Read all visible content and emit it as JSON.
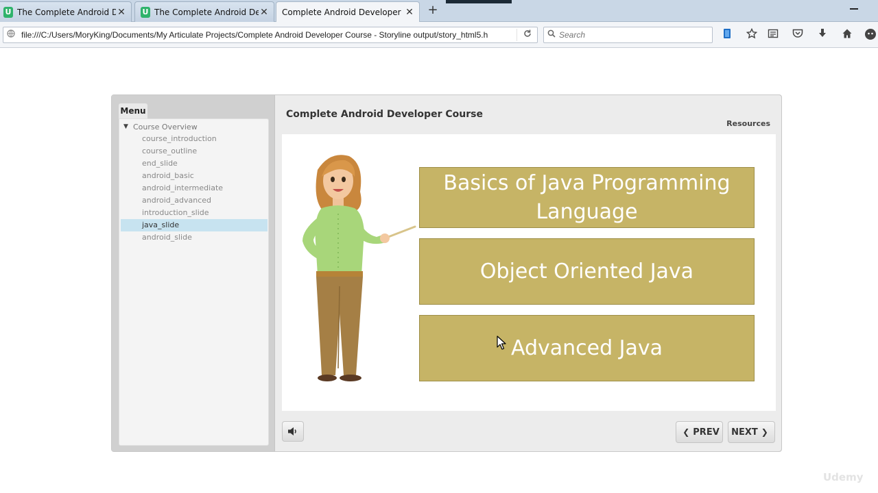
{
  "browser": {
    "tabs": [
      {
        "title": "The Complete Android De...",
        "favicon": "U",
        "active": false
      },
      {
        "title": "The Complete Android De...",
        "favicon": "U",
        "active": false
      },
      {
        "title": "Complete Android Developer C...",
        "favicon": "",
        "active": true
      }
    ],
    "close_glyph": "✕",
    "new_tab_glyph": "+",
    "url": "file:///C:/Users/MoryKing/Documents/My Articulate Projects/Complete Android Developer Course - Storyline output/story_html5.h",
    "search_placeholder": "Search",
    "toolbar_icons": [
      "sync-icon",
      "bookmark-star-icon",
      "reading-list-icon",
      "pocket-icon",
      "download-icon",
      "home-icon",
      "account-icon"
    ]
  },
  "player": {
    "menu_tab_label": "Menu",
    "menu_root": "Course Overview",
    "menu_items": [
      {
        "label": "course_introduction",
        "selected": false
      },
      {
        "label": "course_outline",
        "selected": false
      },
      {
        "label": "end_slide",
        "selected": false
      },
      {
        "label": "android_basic",
        "selected": false
      },
      {
        "label": "android_intermediate",
        "selected": false
      },
      {
        "label": "android_advanced",
        "selected": false
      },
      {
        "label": "introduction_slide",
        "selected": false
      },
      {
        "label": "java_slide",
        "selected": true
      },
      {
        "label": "android_slide",
        "selected": false
      }
    ],
    "course_title": "Complete Android Developer Course",
    "resources_label": "Resources",
    "slide": {
      "topics": [
        "Basics of Java Programming Language",
        "Object Oriented Java",
        "Advanced Java"
      ],
      "box_color": "#c6b466"
    },
    "prev_label": "PREV",
    "next_label": "NEXT"
  },
  "watermark": "Udemy"
}
